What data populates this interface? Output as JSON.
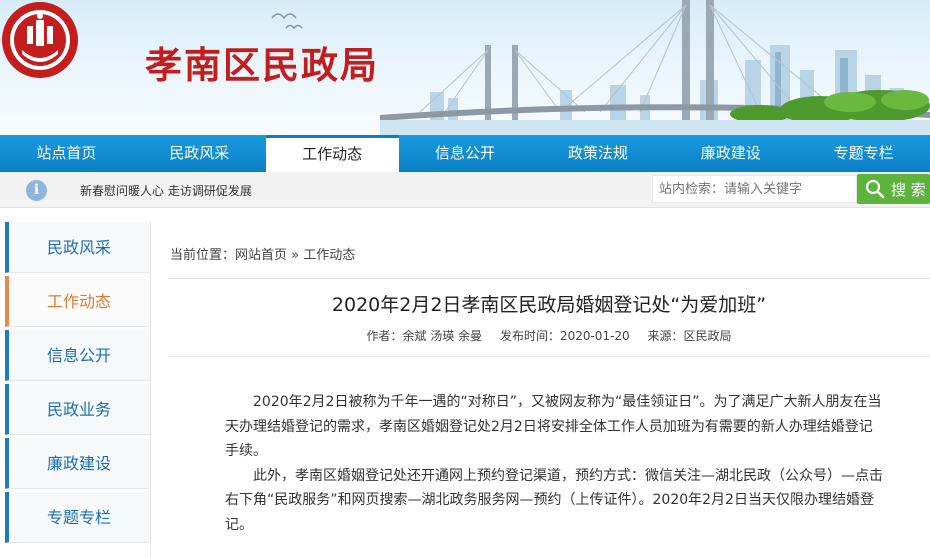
{
  "header": {
    "site_title": "孝南区民政局",
    "brand_color": "#c31d1d",
    "logo_icon": "civil-affairs-emblem-icon"
  },
  "nav": {
    "items": [
      {
        "label": "站点首页"
      },
      {
        "label": "民政风采"
      },
      {
        "label": "工作动态",
        "active": true
      },
      {
        "label": "信息公开"
      },
      {
        "label": "政策法规"
      },
      {
        "label": "廉政建设"
      },
      {
        "label": "专题专栏"
      }
    ],
    "accent_color": "#0b7fc6"
  },
  "notice": {
    "icon": "info-icon",
    "ticker_text": "新春慰问暖人心 走访调研促发展"
  },
  "search": {
    "placeholder": "站内检索：请输入关键字",
    "button_label": "搜 索",
    "button_color": "#5db33c"
  },
  "sidebar": {
    "items": [
      {
        "label": "民政风采"
      },
      {
        "label": "工作动态",
        "active": true
      },
      {
        "label": "信息公开"
      },
      {
        "label": "民政业务"
      },
      {
        "label": "廉政建设"
      },
      {
        "label": "专题专栏"
      }
    ]
  },
  "breadcrumb": {
    "prefix": "当前位置：",
    "home": "网站首页",
    "separator": "»",
    "current": "工作动态"
  },
  "article": {
    "title": "2020年2月2日孝南区民政局婚姻登记处“为爱加班”",
    "author": "作者：余斌 汤瑛 余曼",
    "publish_time": "发布时间：2020-01-20",
    "source": "来源：区民政局",
    "paragraphs": [
      "2020年2月2日被称为千年一遇的“对称日”，又被网友称为“最佳领证日”。为了满足广大新人朋友在当天办理结婚登记的需求，孝南区婚姻登记处2月2日将安排全体工作人员加班为有需要的新人办理结婚登记手续。",
      "此外，孝南区婚姻登记处还开通网上预约登记渠道，预约方式：微信关注—湖北民政（公众号）—点击右下角“民政服务”和网页搜索—湖北政务服务网—预约（上传证件）。2020年2月2日当天仅限办理结婚登记。"
    ]
  }
}
